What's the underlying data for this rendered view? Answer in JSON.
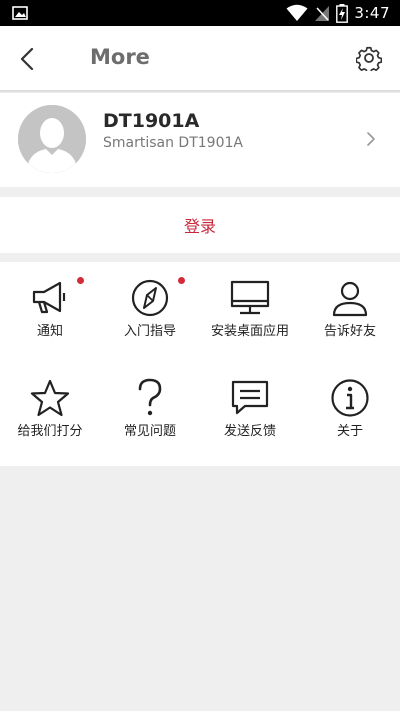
{
  "status_bar": {
    "time": "3:47",
    "icons": [
      "image-icon",
      "wifi-icon",
      "no-signal-icon",
      "battery-charging-icon"
    ]
  },
  "top_bar": {
    "title": "More",
    "back_icon": "chevron-left-icon",
    "settings_icon": "gear-icon"
  },
  "profile": {
    "name": "DT1901A",
    "subtitle": "Smartisan DT1901A"
  },
  "login": {
    "label": "登录",
    "color": "#c8283a"
  },
  "grid": {
    "items": [
      {
        "label": "通知",
        "icon": "megaphone-icon",
        "badge": true
      },
      {
        "label": "入门指导",
        "icon": "compass-icon",
        "badge": true
      },
      {
        "label": "安装桌面应用",
        "icon": "monitor-icon",
        "badge": false
      },
      {
        "label": "告诉好友",
        "icon": "person-icon",
        "badge": false
      },
      {
        "label": "给我们打分",
        "icon": "star-icon",
        "badge": false
      },
      {
        "label": "常见问题",
        "icon": "question-icon",
        "badge": false
      },
      {
        "label": "发送反馈",
        "icon": "message-icon",
        "badge": false
      },
      {
        "label": "关于",
        "icon": "info-icon",
        "badge": false
      }
    ]
  },
  "colors": {
    "accent": "#c8283a",
    "badge": "#d22c3b",
    "background": "#efefef"
  }
}
